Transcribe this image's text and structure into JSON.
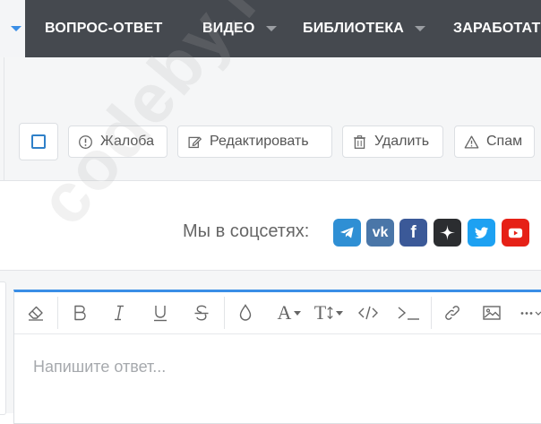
{
  "nav": {
    "items": [
      {
        "label": "ВОПРОС-ОТВЕТ",
        "caret": false
      },
      {
        "label": "ВИДЕО",
        "caret": true
      },
      {
        "label": "БИБЛИОТЕКА",
        "caret": true
      },
      {
        "label": "ЗАРАБОТАТЬ",
        "caret": false
      }
    ]
  },
  "actions": {
    "complaint": "Жалоба",
    "edit": "Редактировать",
    "delete": "Удалить",
    "spam": "Спам"
  },
  "social": {
    "label": "Мы в соцсетях:",
    "networks": [
      {
        "name": "telegram-icon",
        "color": "#2f8fd4"
      },
      {
        "name": "vk-icon",
        "color": "#4a76a8"
      },
      {
        "name": "facebook-icon",
        "color": "#3b5998"
      },
      {
        "name": "zen-icon",
        "color": "#2b2d30"
      },
      {
        "name": "twitter-icon",
        "color": "#1da1f2"
      },
      {
        "name": "youtube-icon",
        "color": "#e62117"
      }
    ]
  },
  "editor": {
    "placeholder": "Напишите ответ...",
    "toolbar": {
      "text_color_label": "A",
      "font_size_label": "T"
    }
  },
  "watermark": "codeby.net",
  "colors": {
    "accent": "#3a8ee6",
    "nav_bg": "#45494f"
  }
}
